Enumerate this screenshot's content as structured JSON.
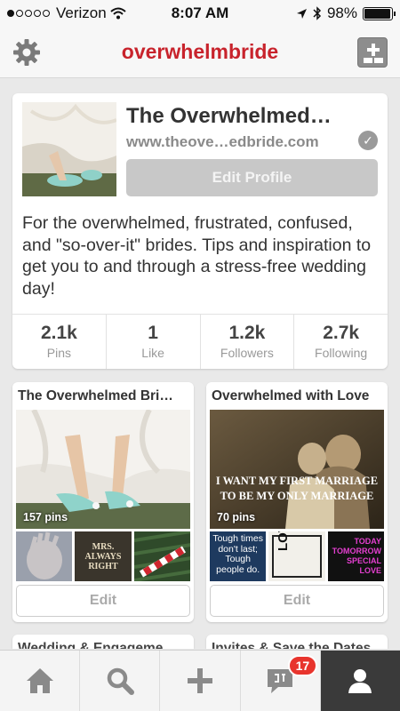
{
  "status_bar": {
    "carrier": "Verizon",
    "time": "8:07 AM",
    "battery": "98%",
    "battery_level": 0.98,
    "signal_bars": 1,
    "icons": [
      "signal-dots-icon",
      "wifi-icon",
      "location-arrow-icon",
      "bluetooth-icon",
      "battery-icon"
    ]
  },
  "nav": {
    "title": "overwhelmbride",
    "left_icon": "gear-icon",
    "right_icon": "add-board-icon",
    "title_color": "#c8232c"
  },
  "profile": {
    "name": "The Overwhelmed…",
    "url": "www.theove…edbride.com",
    "verified_icon": "check-circle-icon",
    "edit_label": "Edit Profile",
    "description": "For the overwhelmed, frustrated, confused, and \"so-over-it\" brides. Tips and inspiration to get you to and through a stress-free wedding day!",
    "stats": [
      {
        "value": "2.1k",
        "label": "Pins"
      },
      {
        "value": "1",
        "label": "Like"
      },
      {
        "value": "1.2k",
        "label": "Followers"
      },
      {
        "value": "2.7k",
        "label": "Following"
      }
    ]
  },
  "boards": [
    {
      "title": "The Overwhelmed Bri…",
      "pin_count": "157 pins",
      "thumb_texts": [
        "",
        "MRS. ALWAYS RIGHT",
        ""
      ],
      "edit_label": "Edit"
    },
    {
      "title": "Overwhelmed with Love",
      "pin_count": "70 pins",
      "cover_text": "I WANT MY FIRST MARRIAGE TO BE MY ONLY MARRIAGE",
      "thumb_texts": [
        "Tough times don't last; Tough people do.",
        "LOVE",
        "TODAY TOMORROW SPECIAL LOVE"
      ],
      "edit_label": "Edit"
    }
  ],
  "partial_boards": [
    {
      "title": "Wedding & Engageme…"
    },
    {
      "title": "Invites & Save the Dates"
    }
  ],
  "tab_bar": {
    "tabs": [
      "home-icon",
      "search-icon",
      "add-icon",
      "notifications-icon",
      "profile-icon"
    ],
    "notification_badge": "17",
    "active_tab": "profile-icon",
    "active_color": "#3a3a3a"
  }
}
